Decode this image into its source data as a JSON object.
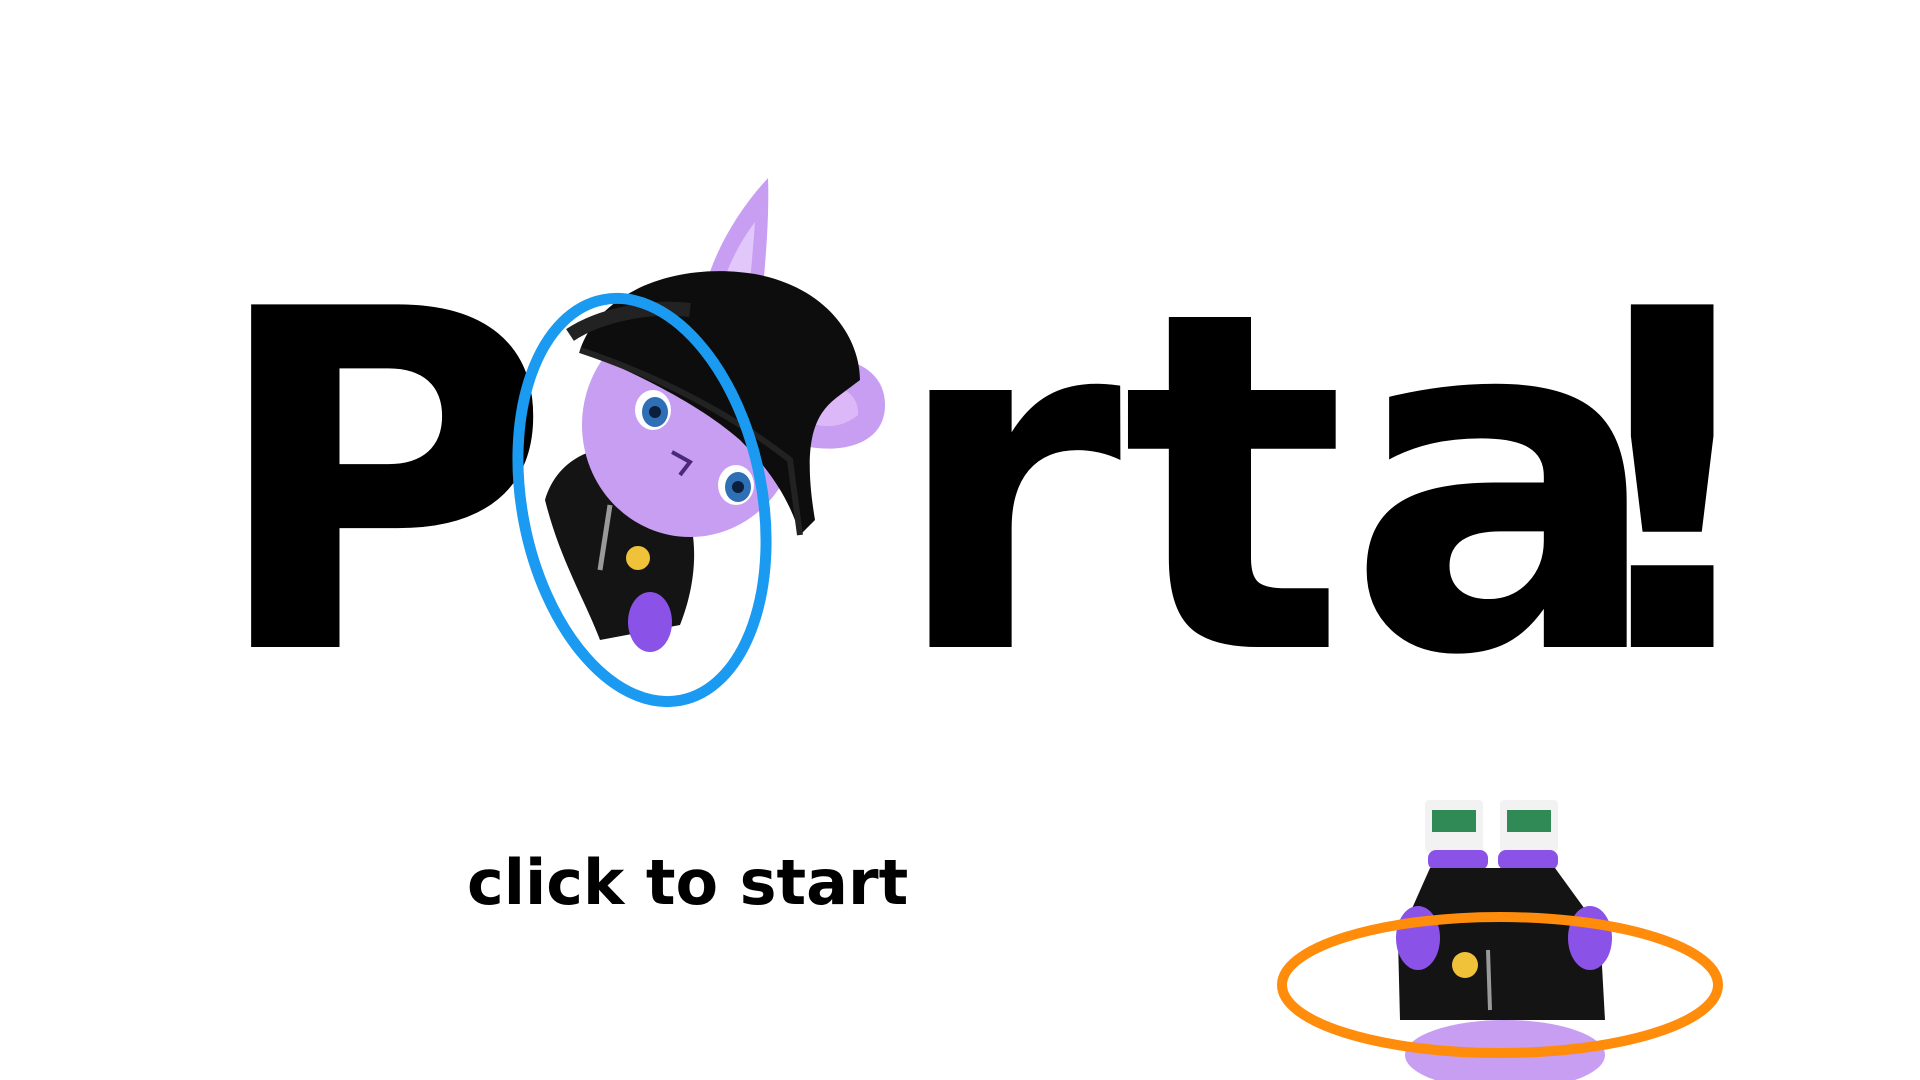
{
  "title": {
    "first_letter": "P",
    "middle_letters": "rta",
    "last_letter": "!"
  },
  "start_prompt": "click to start",
  "colors": {
    "background": "#ffffff",
    "text": "#000000",
    "blue_portal": "#1a9af0",
    "orange_portal": "#ff8c0a",
    "cat_fur": "#c79ef2",
    "cat_fur_shade": "#a87fe0",
    "hat": "#0d0d0d",
    "hoodie": "#141414",
    "eyes": "#2f6fb5",
    "paw": "#8a52e6"
  },
  "icons": {
    "blue_portal": "blue-portal-icon",
    "orange_portal": "orange-portal-icon",
    "cat_mascot": "cat-mascot-icon"
  }
}
